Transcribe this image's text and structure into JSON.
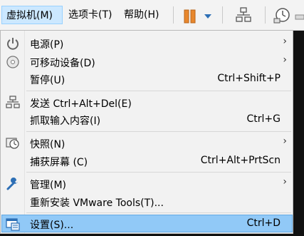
{
  "menubar": {
    "items": [
      {
        "label": "虚拟机(M)"
      },
      {
        "label": "选项卡(T)"
      },
      {
        "label": "帮助(H)"
      }
    ]
  },
  "toolbar": {
    "icons": [
      "pause-icon",
      "dropdown-arrow-icon",
      "network-icon",
      "clock-icon"
    ]
  },
  "menu": {
    "items": [
      {
        "label": "电源(P)",
        "accel": "",
        "submenu": true,
        "icon": "power-icon"
      },
      {
        "label": "可移动设备(D)",
        "accel": "",
        "submenu": true,
        "icon": "disc-icon"
      },
      {
        "label": "暂停(U)",
        "accel": "Ctrl+Shift+P",
        "submenu": false,
        "icon": ""
      },
      {
        "label": "发送 Ctrl+Alt+Del(E)",
        "accel": "",
        "submenu": false,
        "icon": "network-send-icon"
      },
      {
        "label": "抓取输入内容(I)",
        "accel": "Ctrl+G",
        "submenu": false,
        "icon": ""
      },
      {
        "label": "快照(N)",
        "accel": "",
        "submenu": true,
        "icon": "snapshot-clock-icon"
      },
      {
        "label": "捕获屏幕 (C)",
        "accel": "Ctrl+Alt+PrtScn",
        "submenu": false,
        "icon": ""
      },
      {
        "label": "管理(M)",
        "accel": "",
        "submenu": true,
        "icon": "wrench-icon"
      },
      {
        "label": "重新安装 VMware Tools(T)...",
        "accel": "",
        "submenu": false,
        "icon": ""
      },
      {
        "label": "设置(S)...",
        "accel": "Ctrl+D",
        "submenu": false,
        "icon": "settings-icon"
      }
    ],
    "arrow_glyph": "›"
  },
  "colors": {
    "highlight": "#91c9f7",
    "menubar_active": "#cce8ff",
    "pause_orange": "#e8872d",
    "accent_blue": "#2d6fb5"
  }
}
